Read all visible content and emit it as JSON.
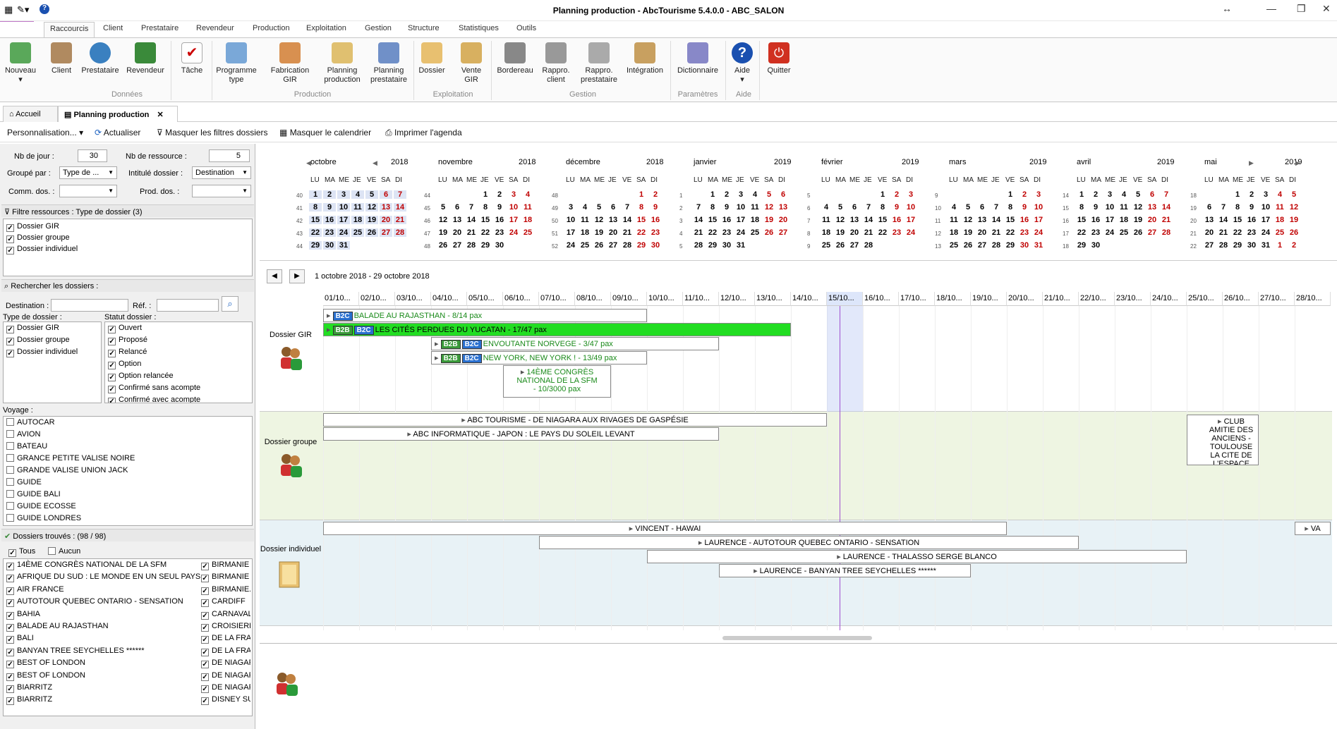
{
  "window": {
    "title": "Planning production - AbcTourisme 5.4.0.0 - ABC_SALON",
    "help_icon": "?"
  },
  "ribbon_tabs": [
    "Raccourcis",
    "Client",
    "Prestataire",
    "Revendeur",
    "Production",
    "Exploitation",
    "Gestion",
    "Structure",
    "Statistiques",
    "Outils"
  ],
  "ribbon": {
    "buttons": [
      {
        "label": "Nouveau"
      },
      {
        "label": "Client"
      },
      {
        "label": "Prestataire"
      },
      {
        "label": "Revendeur"
      },
      {
        "label": "Tâche"
      },
      {
        "label": "Programme type"
      },
      {
        "label": "Fabrication GIR"
      },
      {
        "label": "Planning production"
      },
      {
        "label": "Planning prestataire"
      },
      {
        "label": "Dossier"
      },
      {
        "label": "Vente GIR"
      },
      {
        "label": "Bordereau"
      },
      {
        "label": "Rappro. client"
      },
      {
        "label": "Rappro. prestataire"
      },
      {
        "label": "Intégration"
      },
      {
        "label": "Dictionnaire"
      },
      {
        "label": "Aide"
      },
      {
        "label": "Quitter"
      }
    ],
    "groups": [
      "Données",
      "Production",
      "Exploitation",
      "Gestion",
      "Paramètres",
      "Aide"
    ]
  },
  "doc_tabs": {
    "home": "Accueil",
    "active": "Planning production"
  },
  "toolbar": {
    "personnalisation": "Personnalisation...",
    "actualiser": "Actualiser",
    "masquer_filtres": "Masquer les filtres dossiers",
    "masquer_calendrier": "Masquer le calendrier",
    "imprimer": "Imprimer l'agenda"
  },
  "filters": {
    "nb_jour_label": "Nb de jour :",
    "nb_jour": "30",
    "nb_ressource_label": "Nb de ressource :",
    "nb_ressource": "5",
    "groupe_par_label": "Groupé par :",
    "groupe_par": "Type de ...",
    "intitule_label": "Intitulé dossier :",
    "intitule": "Destination",
    "comm_label": "Comm. dos. :",
    "prod_label": "Prod. dos. :",
    "filtre_ressources": "Filtre ressources : Type de dossier (3)",
    "ressources": [
      "Dossier GIR",
      "Dossier groupe",
      "Dossier individuel"
    ],
    "rechercher": "Rechercher les dossiers :",
    "destination_label": "Destination :",
    "ref_label": "Réf. :",
    "type_label": "Type de dossier :",
    "types": [
      "Dossier GIR",
      "Dossier groupe",
      "Dossier individuel"
    ],
    "statut_label": "Statut dossier :",
    "statuts": [
      "Ouvert",
      "Proposé",
      "Relancé",
      "Option",
      "Option relancée",
      "Confirmé sans acompte",
      "Confirmé avec acompte"
    ],
    "voyage_label": "Voyage :",
    "voyages": [
      "AUTOCAR",
      "AVION",
      "BATEAU",
      "GRANCE PETITE VALISE NOIRE",
      "GRANDE VALISE UNION JACK",
      "GUIDE",
      "GUIDE BALI",
      "GUIDE ECOSSE",
      "GUIDE LONDRES"
    ],
    "trouves": "Dossiers trouvés : (98 / 98)",
    "tous": "Tous",
    "aucun": "Aucun",
    "dossiers_col1": [
      "14ÈME CONGRÈS NATIONAL DE LA SFM",
      "AFRIQUE DU SUD : LE MONDE EN UN SEUL PAYS",
      "AIR FRANCE",
      "AUTOTOUR QUEBEC ONTARIO - SENSATION",
      "BAHIA",
      "BALADE AU RAJASTHAN",
      "BALI",
      "BANYAN TREE SEYCHELLES ******",
      "BEST OF LONDON",
      "BEST OF LONDON",
      "BIARRITZ",
      "BIARRITZ"
    ],
    "dossiers_col2": [
      "BIRMANIE",
      "BIRMANIE",
      "BIRMANIE...",
      "CARDIFF",
      "CARNAVALS",
      "CROISIERE",
      "DE LA FRAN",
      "DE LA FRAN",
      "DE NIAGARA",
      "DE NIAGARA",
      "DE NIAGARA",
      "DISNEY SUR"
    ]
  },
  "calendar": {
    "day_headers": [
      "LU",
      "MA",
      "ME",
      "JE",
      "VE",
      "SA",
      "DI"
    ],
    "months": [
      {
        "name": "octobre",
        "year": "2018",
        "weeks": [
          [
            "40",
            "1",
            "2",
            "3",
            "4",
            "5",
            "6",
            "7"
          ],
          [
            "41",
            "8",
            "9",
            "10",
            "11",
            "12",
            "13",
            "14"
          ],
          [
            "42",
            "15",
            "16",
            "17",
            "18",
            "19",
            "20",
            "21"
          ],
          [
            "43",
            "22",
            "23",
            "24",
            "25",
            "26",
            "27",
            "28"
          ],
          [
            "44",
            "29",
            "30",
            "31",
            "",
            "",
            "",
            ""
          ]
        ]
      },
      {
        "name": "novembre",
        "year": "2018",
        "weeks": [
          [
            "44",
            "",
            "",
            "",
            "1",
            "2",
            "3",
            "4"
          ],
          [
            "45",
            "5",
            "6",
            "7",
            "8",
            "9",
            "10",
            "11"
          ],
          [
            "46",
            "12",
            "13",
            "14",
            "15",
            "16",
            "17",
            "18"
          ],
          [
            "47",
            "19",
            "20",
            "21",
            "22",
            "23",
            "24",
            "25"
          ],
          [
            "48",
            "26",
            "27",
            "28",
            "29",
            "30",
            "",
            ""
          ]
        ]
      },
      {
        "name": "décembre",
        "year": "2018",
        "weeks": [
          [
            "48",
            "",
            "",
            "",
            "",
            "",
            "1",
            "2"
          ],
          [
            "49",
            "3",
            "4",
            "5",
            "6",
            "7",
            "8",
            "9"
          ],
          [
            "50",
            "10",
            "11",
            "12",
            "13",
            "14",
            "15",
            "16"
          ],
          [
            "51",
            "17",
            "18",
            "19",
            "20",
            "21",
            "22",
            "23"
          ],
          [
            "52",
            "24",
            "25",
            "26",
            "27",
            "28",
            "29",
            "30"
          ]
        ]
      },
      {
        "name": "janvier",
        "year": "2019",
        "weeks": [
          [
            "1",
            "",
            "1",
            "2",
            "3",
            "4",
            "5",
            "6"
          ],
          [
            "2",
            "7",
            "8",
            "9",
            "10",
            "11",
            "12",
            "13"
          ],
          [
            "3",
            "14",
            "15",
            "16",
            "17",
            "18",
            "19",
            "20"
          ],
          [
            "4",
            "21",
            "22",
            "23",
            "24",
            "25",
            "26",
            "27"
          ],
          [
            "5",
            "28",
            "29",
            "30",
            "31",
            "",
            "",
            ""
          ]
        ]
      },
      {
        "name": "février",
        "year": "2019",
        "weeks": [
          [
            "5",
            "",
            "",
            "",
            "",
            "1",
            "2",
            "3"
          ],
          [
            "6",
            "4",
            "5",
            "6",
            "7",
            "8",
            "9",
            "10"
          ],
          [
            "7",
            "11",
            "12",
            "13",
            "14",
            "15",
            "16",
            "17"
          ],
          [
            "8",
            "18",
            "19",
            "20",
            "21",
            "22",
            "23",
            "24"
          ],
          [
            "9",
            "25",
            "26",
            "27",
            "28",
            "",
            "",
            ""
          ]
        ]
      },
      {
        "name": "mars",
        "year": "2019",
        "weeks": [
          [
            "9",
            "",
            "",
            "",
            "",
            "1",
            "2",
            "3"
          ],
          [
            "10",
            "4",
            "5",
            "6",
            "7",
            "8",
            "9",
            "10"
          ],
          [
            "11",
            "11",
            "12",
            "13",
            "14",
            "15",
            "16",
            "17"
          ],
          [
            "12",
            "18",
            "19",
            "20",
            "21",
            "22",
            "23",
            "24"
          ],
          [
            "13",
            "25",
            "26",
            "27",
            "28",
            "29",
            "30",
            "31"
          ]
        ]
      },
      {
        "name": "avril",
        "year": "2019",
        "weeks": [
          [
            "14",
            "1",
            "2",
            "3",
            "4",
            "5",
            "6",
            "7"
          ],
          [
            "15",
            "8",
            "9",
            "10",
            "11",
            "12",
            "13",
            "14"
          ],
          [
            "16",
            "15",
            "16",
            "17",
            "18",
            "19",
            "20",
            "21"
          ],
          [
            "17",
            "22",
            "23",
            "24",
            "25",
            "26",
            "27",
            "28"
          ],
          [
            "18",
            "29",
            "30",
            "",
            "",
            "",
            "",
            ""
          ]
        ]
      },
      {
        "name": "mai",
        "year": "2019",
        "weeks": [
          [
            "18",
            "",
            "",
            "1",
            "2",
            "3",
            "4",
            "5"
          ],
          [
            "19",
            "6",
            "7",
            "8",
            "9",
            "10",
            "11",
            "12"
          ],
          [
            "20",
            "13",
            "14",
            "15",
            "16",
            "17",
            "18",
            "19"
          ],
          [
            "21",
            "20",
            "21",
            "22",
            "23",
            "24",
            "25",
            "26"
          ],
          [
            "22",
            "27",
            "28",
            "29",
            "30",
            "31",
            "1",
            "2"
          ]
        ]
      }
    ]
  },
  "range_label": "1 octobre 2018 - 29 octobre 2018",
  "gantt": {
    "dates": [
      "01/10...",
      "02/10...",
      "03/10...",
      "04/10...",
      "05/10...",
      "06/10...",
      "07/10...",
      "08/10...",
      "09/10...",
      "10/10...",
      "11/10...",
      "12/10...",
      "13/10...",
      "14/10...",
      "15/10...",
      "16/10...",
      "17/10...",
      "18/10...",
      "19/10...",
      "20/10...",
      "21/10...",
      "22/10...",
      "23/10...",
      "24/10...",
      "25/10...",
      "26/10...",
      "27/10...",
      "28/10..."
    ],
    "lanes": [
      {
        "label": "Dossier GIR",
        "bars": [
          {
            "text": "BALADE AU RAJASTHAN - 8/14 pax",
            "tags": [
              "B2C"
            ],
            "start": 0,
            "end": 9
          },
          {
            "text": "LES CITÉS PERDUES DU YUCATAN - 17/47 pax",
            "tags": [
              "B2B",
              "B2C"
            ],
            "start": 0,
            "end": 13
          },
          {
            "text": "ENVOUTANTE NORVEGE - 3/47 pax",
            "tags": [
              "B2B",
              "B2C"
            ],
            "start": 3,
            "end": 11
          },
          {
            "text": "NEW YORK, NEW YORK ! - 13/49 pax",
            "tags": [
              "B2B",
              "B2C"
            ],
            "start": 3,
            "end": 9
          },
          {
            "text": "14ÈME CONGRÈS NATIONAL DE LA SFM - 10/3000 pax",
            "tags": [],
            "start": 5,
            "end": 8
          }
        ]
      },
      {
        "label": "Dossier groupe",
        "bars": [
          {
            "text": "ABC TOURISME - DE NIAGARA AUX RIVAGES DE GASPÉSIE",
            "tags": [],
            "start": 0,
            "end": 14
          },
          {
            "text": "ABC INFORMATIQUE - JAPON : LE PAYS DU SOLEIL LEVANT",
            "tags": [],
            "start": 0,
            "end": 11
          },
          {
            "text": "CLUB AMITIE DES ANCIENS - TOULOUSE LA CITE DE L'ESPACE",
            "tags": [],
            "start": 24,
            "end": 26
          }
        ]
      },
      {
        "label": "Dossier individuel",
        "bars": [
          {
            "text": "VINCENT - HAWAI",
            "tags": [],
            "start": 0,
            "end": 19
          },
          {
            "text": "LAURENCE - AUTOTOUR QUEBEC ONTARIO - SENSATION",
            "tags": [],
            "start": 6,
            "end": 21
          },
          {
            "text": "LAURENCE - THALASSO SERGE BLANCO",
            "tags": [],
            "start": 9,
            "end": 24
          },
          {
            "text": "LAURENCE - BANYAN TREE SEYCHELLES ******",
            "tags": [],
            "start": 11,
            "end": 18
          },
          {
            "text": "VA",
            "tags": [],
            "start": 27,
            "end": 28
          }
        ]
      }
    ]
  }
}
